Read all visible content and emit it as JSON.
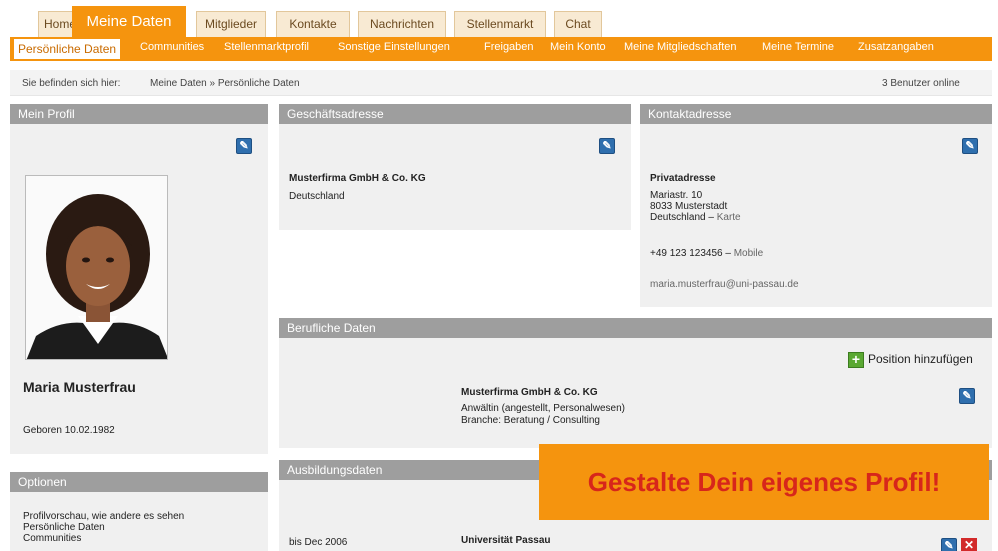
{
  "tabs": [
    "Home",
    "Meine Daten",
    "Mitglieder",
    "Kontakte",
    "Nachrichten",
    "Stellenmarkt",
    "Chat"
  ],
  "active_tab": "Meine Daten",
  "subnav": [
    "Persönliche Daten",
    "Communities",
    "Stellenmarktprofil",
    "Sonstige Einstellungen",
    "Freigaben",
    "Mein Konto",
    "Meine Mitgliedschaften",
    "Meine Termine",
    "Zusatzangaben"
  ],
  "breadcrumb": {
    "label": "Sie befinden sich hier:",
    "path": "Meine Daten » Persönliche Daten",
    "online": "3 Benutzer online"
  },
  "profile": {
    "header": "Mein Profil",
    "name": "Maria Musterfrau",
    "born": "Geboren 10.02.1982"
  },
  "options": {
    "header": "Optionen",
    "items": [
      "Profilvorschau, wie andere es sehen",
      "Persönliche Daten",
      "Communities"
    ]
  },
  "business_address": {
    "header": "Geschäftsadresse",
    "company": "Musterfirma GmbH & Co. KG",
    "country": "Deutschland"
  },
  "contact_address": {
    "header": "Kontaktadresse",
    "title": "Privatadresse",
    "street": "Mariastr. 10",
    "city": "8033 Musterstadt",
    "country": "Deutschland",
    "map_link": "Karte",
    "phone": "+49 123 123456",
    "phone_type": "Mobile",
    "email": "maria.musterfrau@uni-passau.de"
  },
  "professional": {
    "header": "Berufliche Daten",
    "add_label": "Position hinzufügen",
    "company": "Musterfirma GmbH & Co. KG",
    "role": "Anwältin (angestellt, Personalwesen)",
    "branch": "Branche: Beratung / Consulting"
  },
  "education": {
    "header": "Ausbildungsdaten",
    "period": "bis Dec 2006",
    "institution": "Universität Passau"
  },
  "promo": "Gestalte Dein eigenes Profil!",
  "colors": {
    "accent": "#f5940e",
    "panel_header": "#9e9e9e",
    "promo_text": "#d7261b"
  }
}
